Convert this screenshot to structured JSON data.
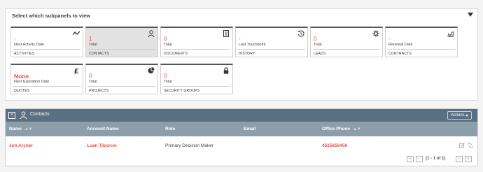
{
  "subpanels": {
    "title": "Select which subpanels to view",
    "tiles": [
      {
        "value": "-",
        "label": "Next Activity Date",
        "name": "ACTIVITIES",
        "icon": "trend-icon"
      },
      {
        "value": "1",
        "label": "Total",
        "name": "CONTACTS",
        "icon": "person-icon",
        "active": true
      },
      {
        "value": "0",
        "label": "Total",
        "name": "DOCUMENTS",
        "icon": "document-icon"
      },
      {
        "value": "-",
        "label": "Last Touchpoint",
        "name": "HISTORY",
        "icon": "history-icon"
      },
      {
        "value": "0",
        "label": "Total",
        "name": "LEADS",
        "icon": "gear-icon"
      },
      {
        "value": "-",
        "label": "Renewal Date",
        "name": "CONTRACTS",
        "icon": "contract-icon"
      },
      {
        "value": "None",
        "label": "Next Expiration Date",
        "name": "QUOTES",
        "icon": "pound-icon"
      },
      {
        "value": "0",
        "label": "Total",
        "name": "PROJECTS",
        "icon": "pie-icon"
      },
      {
        "value": "0",
        "label": "Total",
        "name": "SECURITY GROUPS",
        "icon": "lock-icon"
      }
    ]
  },
  "contacts": {
    "close_label": "×",
    "title": "Contacts",
    "actions_label": "Actions",
    "columns": [
      "Name",
      "Account Name",
      "Role",
      "Email",
      "Office Phone"
    ],
    "rows": [
      {
        "name": "Jun Archer",
        "account": "Luan Tiburcio",
        "role": "Primary Decision Maker",
        "email": "",
        "phone": "4515656456"
      }
    ],
    "pagination": {
      "first": "«",
      "prev": "‹",
      "label": "(1 - 1 of 1)",
      "next": "›",
      "last": "»"
    }
  }
}
